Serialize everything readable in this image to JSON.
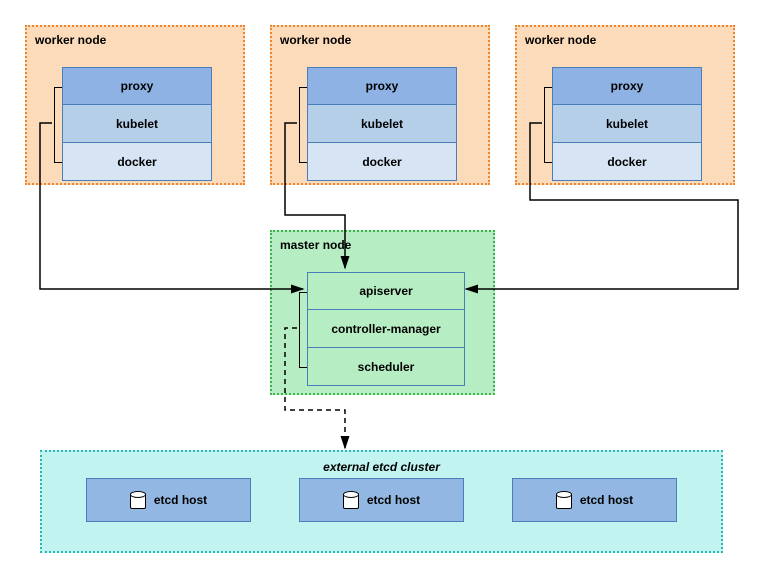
{
  "workers": [
    {
      "title": "worker node",
      "proxy": "proxy",
      "kubelet": "kubelet",
      "docker": "docker"
    },
    {
      "title": "worker node",
      "proxy": "proxy",
      "kubelet": "kubelet",
      "docker": "docker"
    },
    {
      "title": "worker node",
      "proxy": "proxy",
      "kubelet": "kubelet",
      "docker": "docker"
    }
  ],
  "master": {
    "title": "master node",
    "apiserver": "apiserver",
    "controller_manager": "controller-manager",
    "scheduler": "scheduler"
  },
  "etcd": {
    "title": "external etcd cluster",
    "hosts": [
      "etcd host",
      "etcd host",
      "etcd host"
    ]
  },
  "colors": {
    "worker_bg": "#fcdbba",
    "worker_border": "#f0862f",
    "master_bg": "#b7edc2",
    "master_border": "#3eb24d",
    "etcd_bg": "#c1f3f0",
    "etcd_border": "#2fb5af",
    "box_blue1": "#8db2e3",
    "box_blue2": "#b5cfe9",
    "box_blue3": "#d6e4f3",
    "box_border": "#4a7ebb"
  }
}
